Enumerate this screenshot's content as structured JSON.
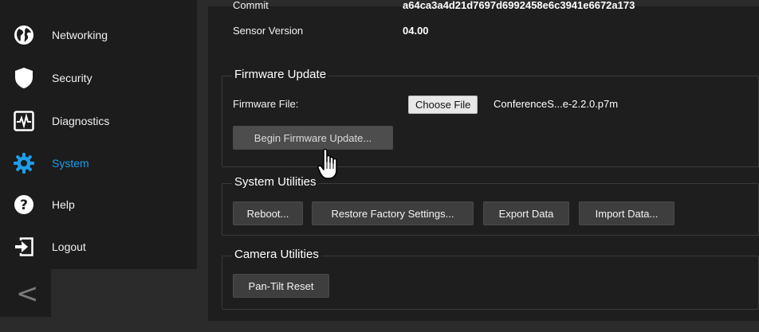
{
  "sidebar": {
    "items": [
      {
        "label": "Networking",
        "icon": "globe-icon"
      },
      {
        "label": "Security",
        "icon": "shield-icon"
      },
      {
        "label": "Diagnostics",
        "icon": "pulse-icon"
      },
      {
        "label": "System",
        "icon": "gear-icon",
        "active": true
      },
      {
        "label": "Help",
        "icon": "question-icon"
      },
      {
        "label": "Logout",
        "icon": "logout-icon"
      }
    ],
    "collapse_glyph": "<"
  },
  "info": {
    "commit_label": "Commit",
    "commit_value": "a64ca3a4d21d7697d6992458e6c3941e6672a173",
    "sensor_label": "Sensor Version",
    "sensor_value": "04.00"
  },
  "firmware": {
    "legend": "Firmware Update",
    "file_label": "Firmware File:",
    "choose_label": "Choose File",
    "file_name": "ConferenceS...e-2.2.0.p7m",
    "begin_label": "Begin Firmware Update..."
  },
  "system_utilities": {
    "legend": "System Utilities",
    "reboot_label": "Reboot...",
    "restore_label": "Restore Factory Settings...",
    "export_label": "Export Data",
    "import_label": "Import Data..."
  },
  "camera_utilities": {
    "legend": "Camera Utilities",
    "pan_tilt_label": "Pan-Tilt Reset"
  },
  "colors": {
    "accent": "#1e9de8",
    "sidebar_bg": "#1c1c1c",
    "panel_bg": "#1e1e1e",
    "page_bg": "#2b2b2b"
  }
}
